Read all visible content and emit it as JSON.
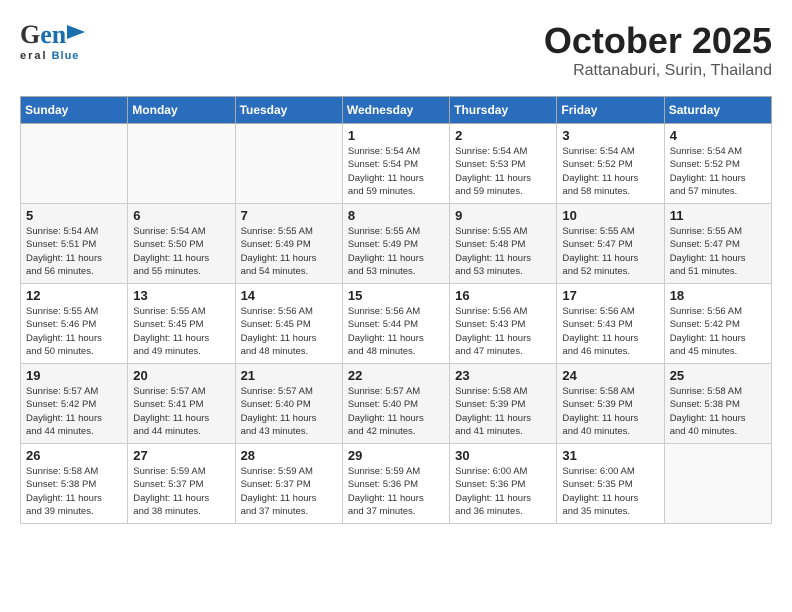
{
  "header": {
    "logo_general": "General",
    "logo_blue": "Blue",
    "month": "October 2025",
    "location": "Rattanaburi, Surin, Thailand"
  },
  "days_of_week": [
    "Sunday",
    "Monday",
    "Tuesday",
    "Wednesday",
    "Thursday",
    "Friday",
    "Saturday"
  ],
  "weeks": [
    [
      {
        "day": "",
        "info": ""
      },
      {
        "day": "",
        "info": ""
      },
      {
        "day": "",
        "info": ""
      },
      {
        "day": "1",
        "info": "Sunrise: 5:54 AM\nSunset: 5:54 PM\nDaylight: 11 hours\nand 59 minutes."
      },
      {
        "day": "2",
        "info": "Sunrise: 5:54 AM\nSunset: 5:53 PM\nDaylight: 11 hours\nand 59 minutes."
      },
      {
        "day": "3",
        "info": "Sunrise: 5:54 AM\nSunset: 5:52 PM\nDaylight: 11 hours\nand 58 minutes."
      },
      {
        "day": "4",
        "info": "Sunrise: 5:54 AM\nSunset: 5:52 PM\nDaylight: 11 hours\nand 57 minutes."
      }
    ],
    [
      {
        "day": "5",
        "info": "Sunrise: 5:54 AM\nSunset: 5:51 PM\nDaylight: 11 hours\nand 56 minutes."
      },
      {
        "day": "6",
        "info": "Sunrise: 5:54 AM\nSunset: 5:50 PM\nDaylight: 11 hours\nand 55 minutes."
      },
      {
        "day": "7",
        "info": "Sunrise: 5:55 AM\nSunset: 5:49 PM\nDaylight: 11 hours\nand 54 minutes."
      },
      {
        "day": "8",
        "info": "Sunrise: 5:55 AM\nSunset: 5:49 PM\nDaylight: 11 hours\nand 53 minutes."
      },
      {
        "day": "9",
        "info": "Sunrise: 5:55 AM\nSunset: 5:48 PM\nDaylight: 11 hours\nand 53 minutes."
      },
      {
        "day": "10",
        "info": "Sunrise: 5:55 AM\nSunset: 5:47 PM\nDaylight: 11 hours\nand 52 minutes."
      },
      {
        "day": "11",
        "info": "Sunrise: 5:55 AM\nSunset: 5:47 PM\nDaylight: 11 hours\nand 51 minutes."
      }
    ],
    [
      {
        "day": "12",
        "info": "Sunrise: 5:55 AM\nSunset: 5:46 PM\nDaylight: 11 hours\nand 50 minutes."
      },
      {
        "day": "13",
        "info": "Sunrise: 5:55 AM\nSunset: 5:45 PM\nDaylight: 11 hours\nand 49 minutes."
      },
      {
        "day": "14",
        "info": "Sunrise: 5:56 AM\nSunset: 5:45 PM\nDaylight: 11 hours\nand 48 minutes."
      },
      {
        "day": "15",
        "info": "Sunrise: 5:56 AM\nSunset: 5:44 PM\nDaylight: 11 hours\nand 48 minutes."
      },
      {
        "day": "16",
        "info": "Sunrise: 5:56 AM\nSunset: 5:43 PM\nDaylight: 11 hours\nand 47 minutes."
      },
      {
        "day": "17",
        "info": "Sunrise: 5:56 AM\nSunset: 5:43 PM\nDaylight: 11 hours\nand 46 minutes."
      },
      {
        "day": "18",
        "info": "Sunrise: 5:56 AM\nSunset: 5:42 PM\nDaylight: 11 hours\nand 45 minutes."
      }
    ],
    [
      {
        "day": "19",
        "info": "Sunrise: 5:57 AM\nSunset: 5:42 PM\nDaylight: 11 hours\nand 44 minutes."
      },
      {
        "day": "20",
        "info": "Sunrise: 5:57 AM\nSunset: 5:41 PM\nDaylight: 11 hours\nand 44 minutes."
      },
      {
        "day": "21",
        "info": "Sunrise: 5:57 AM\nSunset: 5:40 PM\nDaylight: 11 hours\nand 43 minutes."
      },
      {
        "day": "22",
        "info": "Sunrise: 5:57 AM\nSunset: 5:40 PM\nDaylight: 11 hours\nand 42 minutes."
      },
      {
        "day": "23",
        "info": "Sunrise: 5:58 AM\nSunset: 5:39 PM\nDaylight: 11 hours\nand 41 minutes."
      },
      {
        "day": "24",
        "info": "Sunrise: 5:58 AM\nSunset: 5:39 PM\nDaylight: 11 hours\nand 40 minutes."
      },
      {
        "day": "25",
        "info": "Sunrise: 5:58 AM\nSunset: 5:38 PM\nDaylight: 11 hours\nand 40 minutes."
      }
    ],
    [
      {
        "day": "26",
        "info": "Sunrise: 5:58 AM\nSunset: 5:38 PM\nDaylight: 11 hours\nand 39 minutes."
      },
      {
        "day": "27",
        "info": "Sunrise: 5:59 AM\nSunset: 5:37 PM\nDaylight: 11 hours\nand 38 minutes."
      },
      {
        "day": "28",
        "info": "Sunrise: 5:59 AM\nSunset: 5:37 PM\nDaylight: 11 hours\nand 37 minutes."
      },
      {
        "day": "29",
        "info": "Sunrise: 5:59 AM\nSunset: 5:36 PM\nDaylight: 11 hours\nand 37 minutes."
      },
      {
        "day": "30",
        "info": "Sunrise: 6:00 AM\nSunset: 5:36 PM\nDaylight: 11 hours\nand 36 minutes."
      },
      {
        "day": "31",
        "info": "Sunrise: 6:00 AM\nSunset: 5:35 PM\nDaylight: 11 hours\nand 35 minutes."
      },
      {
        "day": "",
        "info": ""
      }
    ]
  ]
}
